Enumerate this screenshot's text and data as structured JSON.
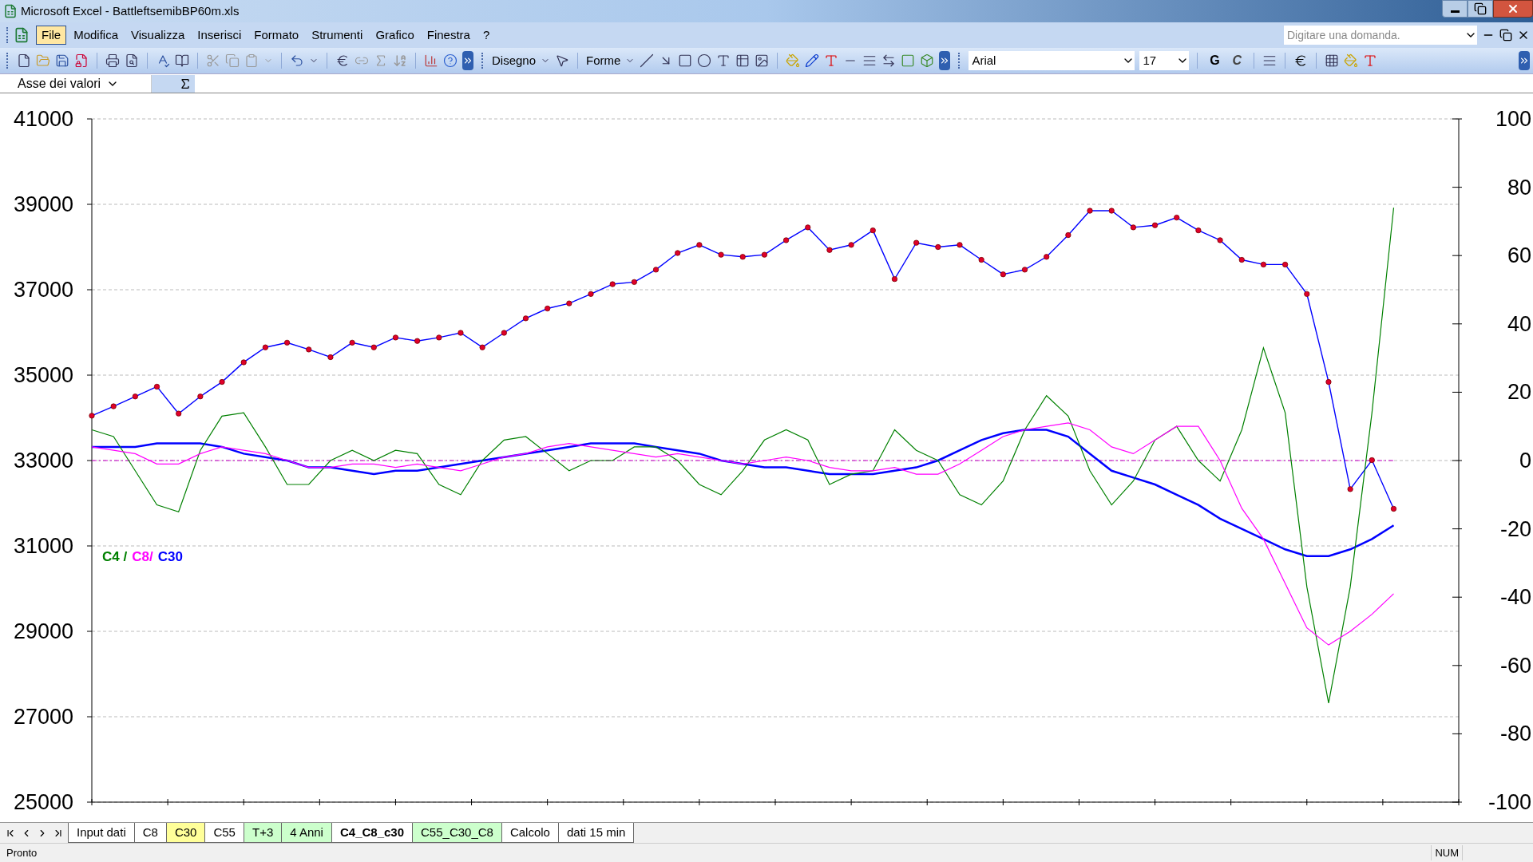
{
  "title_bar": {
    "title": "Microsoft Excel - BattleftsemibBP60m.xls"
  },
  "menu": [
    {
      "label": "File",
      "selected": true
    },
    {
      "label": "Modifica",
      "selected": false
    },
    {
      "label": "Visualizza",
      "selected": false
    },
    {
      "label": "Inserisci",
      "selected": false
    },
    {
      "label": "Formato",
      "selected": false
    },
    {
      "label": "Strumenti",
      "selected": false
    },
    {
      "label": "Grafico",
      "selected": false
    },
    {
      "label": "Finestra",
      "selected": false
    },
    {
      "label": "?",
      "selected": false
    }
  ],
  "help_box": {
    "placeholder": "Digitare una domanda."
  },
  "drawing_toolbar": {
    "draw_menu": "Disegno",
    "shapes_menu": "Forme"
  },
  "format_toolbar": {
    "font": "Arial",
    "size": "17",
    "bold": "G",
    "italic": "C"
  },
  "formula_bar": {
    "name_box": "Asse dei valori"
  },
  "chart": {
    "chart_data": {
      "type": "line",
      "grid": true,
      "ref_lines": [
        {
          "axis": "y2",
          "value": 0,
          "color": "#cc00cc"
        }
      ],
      "ylim": [
        25000,
        41000
      ],
      "yticks": [
        25000,
        27000,
        29000,
        31000,
        33000,
        35000,
        37000,
        39000,
        41000
      ],
      "y2lim": [
        -100,
        100
      ],
      "y2ticks": [
        -100,
        -80,
        -60,
        -40,
        -20,
        0,
        20,
        40,
        60,
        80,
        100
      ],
      "series": [
        {
          "color": "#0000ff",
          "marker": true,
          "values": [
            34050,
            34270,
            34500,
            34730,
            34100,
            34500,
            34840,
            35300,
            35650,
            35760,
            35600,
            35420,
            35760,
            35650,
            35880,
            35800,
            35880,
            35990,
            35650,
            35990,
            36330,
            36560,
            36680,
            36900,
            37130,
            37180,
            37470,
            37860,
            38050,
            37820,
            37770,
            37820,
            38160,
            38460,
            37930,
            38050,
            38390,
            37250,
            38100,
            38000,
            38050,
            37700,
            37360,
            37470,
            37770,
            38280,
            38850,
            38850,
            38460,
            38510,
            38690,
            38390,
            38160,
            37700,
            37590,
            37590,
            36900,
            34840,
            32330,
            33010,
            31870
          ]
        },
        {
          "name": "C4",
          "axis": "y2",
          "color": "#008000",
          "values": [
            9,
            7,
            -3,
            -13,
            -15,
            3,
            13,
            14,
            4,
            -7,
            -7,
            0,
            3,
            0,
            3,
            2,
            -7,
            -10,
            0,
            6,
            7,
            2,
            -3,
            0,
            0,
            4,
            4,
            0,
            -7,
            -10,
            -3,
            6,
            9,
            6,
            -7,
            -4,
            -3,
            9,
            3,
            0,
            -10,
            -13,
            -6,
            9,
            19,
            13,
            -3,
            -13,
            -6,
            6,
            10,
            0,
            -6,
            9,
            33,
            14,
            -37,
            -71,
            -37,
            14,
            74
          ]
        },
        {
          "name": "C8",
          "axis": "y2",
          "color": "#ff00ff",
          "values": [
            4,
            3,
            2,
            -1,
            -1,
            2,
            4,
            3,
            2,
            0,
            -2,
            -2,
            -1,
            -1,
            -2,
            -1,
            -2,
            -3,
            -1,
            1,
            2,
            4,
            5,
            4,
            3,
            2,
            1,
            2,
            1,
            0,
            -1,
            0,
            1,
            0,
            -2,
            -3,
            -3,
            -2,
            -4,
            -4,
            -1,
            3,
            7,
            9,
            10,
            11,
            9,
            4,
            2,
            6,
            10,
            10,
            0,
            -14,
            -23,
            -36,
            -49,
            -54,
            -50,
            -45,
            -39
          ]
        },
        {
          "name": "C30",
          "axis": "y2",
          "color": "#0000ff",
          "values": [
            4,
            4,
            4,
            5,
            5,
            5,
            4,
            2,
            1,
            0,
            -2,
            -2,
            -3,
            -4,
            -3,
            -3,
            -2,
            -1,
            0,
            1,
            2,
            3,
            4,
            5,
            5,
            5,
            4,
            3,
            2,
            0,
            -1,
            -2,
            -2,
            -3,
            -4,
            -4,
            -4,
            -3,
            -2,
            0,
            3,
            6,
            8,
            9,
            9,
            7,
            2,
            -3,
            -5,
            -7,
            -10,
            -13,
            -17,
            -20,
            -23,
            -26,
            -28,
            -28,
            -26,
            -23,
            -19
          ]
        }
      ]
    },
    "legend_separators": [
      " /",
      "/"
    ]
  },
  "sheet_tabs": [
    {
      "label": "Input dati",
      "selected": false,
      "color": "#ffffff"
    },
    {
      "label": "C8",
      "selected": false,
      "color": "#ffffff"
    },
    {
      "label": "C30",
      "selected": false,
      "color": "#ffff99"
    },
    {
      "label": "C55",
      "selected": false,
      "color": "#ffffff"
    },
    {
      "label": "T+3",
      "selected": false,
      "color": "#ccffcc"
    },
    {
      "label": "4 Anni",
      "selected": false,
      "color": "#ccffcc"
    },
    {
      "label": "C4_C8_c30",
      "selected": true,
      "color": "#ffffff"
    },
    {
      "label": "C55_C30_C8",
      "selected": false,
      "color": "#ccffcc"
    },
    {
      "label": "Calcolo",
      "selected": false,
      "color": "#ffffff"
    },
    {
      "label": "dati 15 min",
      "selected": false,
      "color": "#ffffff"
    }
  ],
  "status_bar": {
    "state": "Pronto",
    "indicator": "NUM"
  }
}
